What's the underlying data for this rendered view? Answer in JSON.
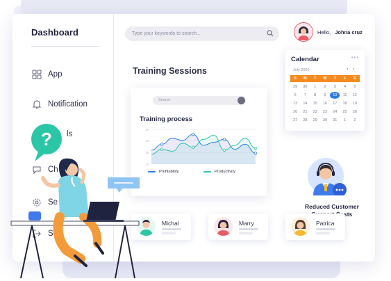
{
  "sidebar": {
    "title": "Dashboard",
    "items": [
      {
        "label": "App",
        "icon": "grid-icon"
      },
      {
        "label": "Notification",
        "icon": "bell-icon"
      },
      {
        "label": "ls",
        "icon": "tools-icon"
      },
      {
        "label": "Ch",
        "icon": "chat-icon"
      },
      {
        "label": "Se",
        "icon": "gear-icon"
      },
      {
        "label": "Sig",
        "icon": "sign-out-icon"
      }
    ]
  },
  "header": {
    "search_placeholder": "Type your keywords to search...",
    "greeting": "Hello,",
    "user_name": "Johna cruz"
  },
  "main": {
    "section_title": "Training Sessions",
    "chart_card": {
      "search_placeholder": "Search",
      "title": "Training process"
    }
  },
  "chart_data": {
    "type": "line",
    "title": "Training process",
    "x": [
      0,
      1,
      2,
      3,
      4,
      5,
      6,
      7,
      8,
      9,
      10
    ],
    "series": [
      {
        "name": "Profitability",
        "color": "#2c7be5",
        "values": [
          28,
          40,
          52,
          48,
          60,
          38,
          44,
          50,
          30,
          40,
          22
        ]
      },
      {
        "name": "Productivity",
        "color": "#2bc6a6",
        "values": [
          20,
          30,
          26,
          42,
          34,
          50,
          58,
          28,
          38,
          52,
          32
        ]
      }
    ],
    "ylim": [
      0,
      70
    ],
    "y_ticks": [
      "80",
      "60",
      "40",
      "20"
    ],
    "grid": true,
    "legend": "bottom"
  },
  "calendar": {
    "title": "Calendar",
    "month_label": "July 2020",
    "weekdays": [
      "S",
      "M",
      "T",
      "W",
      "T",
      "F",
      "S"
    ],
    "days": [
      "29",
      "30",
      "1",
      "2",
      "3",
      "4",
      "5",
      "6",
      "7",
      "8",
      "9",
      "10",
      "11",
      "12",
      "13",
      "14",
      "15",
      "16",
      "17",
      "18",
      "19",
      "20",
      "21",
      "22",
      "23",
      "24",
      "25",
      "26",
      "27",
      "28",
      "29",
      "30",
      "31",
      "1",
      "2"
    ],
    "today": "10",
    "accent": "#f58a1f",
    "today_color": "#2c7be5"
  },
  "support": {
    "caption_line1": "Reduced Customer",
    "caption_line2": "Support Costs"
  },
  "people": [
    {
      "name": "Michal"
    },
    {
      "name": "Marry"
    },
    {
      "name": "Patrica"
    }
  ]
}
